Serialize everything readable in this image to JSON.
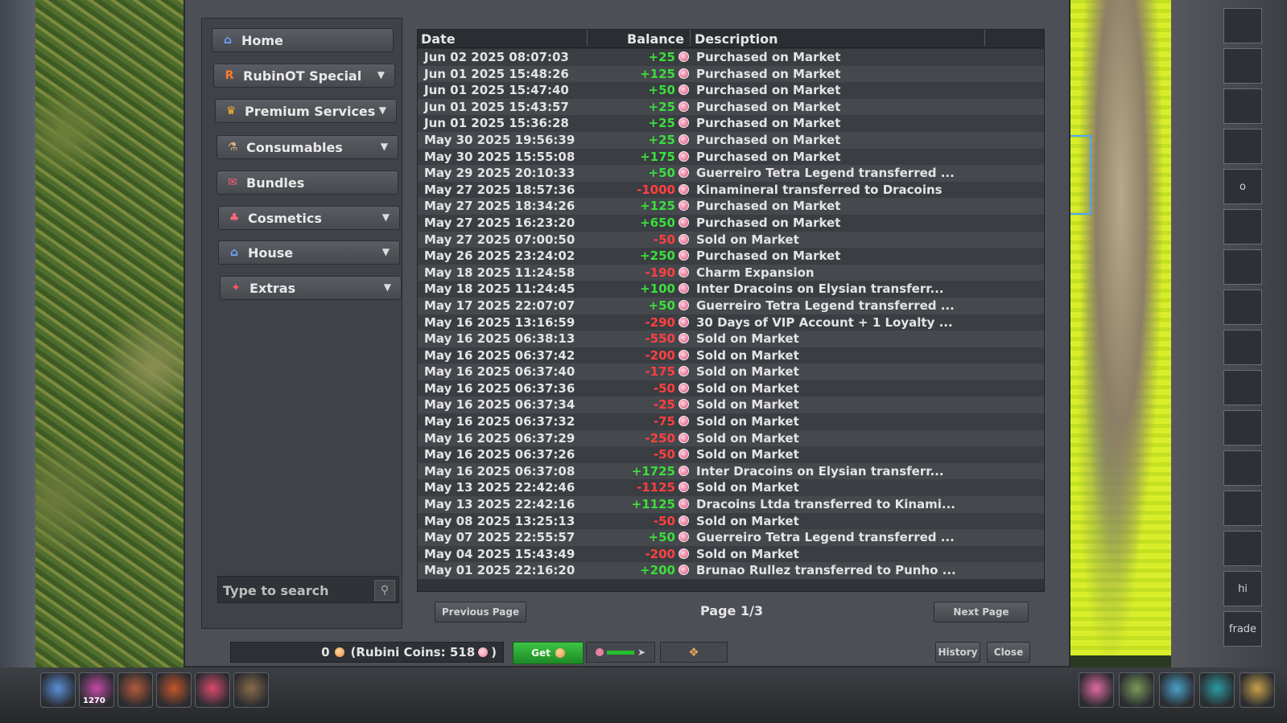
{
  "sidebar": {
    "items": [
      {
        "label": "Home",
        "icon": "house-icon",
        "has_dropdown": false
      },
      {
        "label": "RubinOT Special",
        "icon": "rubinot-logo-icon",
        "has_dropdown": true
      },
      {
        "label": "Premium Services",
        "icon": "crown-icon",
        "has_dropdown": true
      },
      {
        "label": "Consumables",
        "icon": "potion-icon",
        "has_dropdown": true
      },
      {
        "label": "Bundles",
        "icon": "gift-icon",
        "has_dropdown": false
      },
      {
        "label": "Cosmetics",
        "icon": "cosmetic-icon",
        "has_dropdown": true
      },
      {
        "label": "House",
        "icon": "house-icon",
        "has_dropdown": true
      },
      {
        "label": "Extras",
        "icon": "extras-icon",
        "has_dropdown": true
      }
    ],
    "search_placeholder": "Type to search"
  },
  "history": {
    "columns": {
      "date": "Date",
      "balance": "Balance",
      "description": "Description"
    },
    "rows": [
      {
        "date": "Jun 02 2025 08:07:03",
        "balance": "+25",
        "description": "Purchased on Market"
      },
      {
        "date": "Jun 01 2025 15:48:26",
        "balance": "+125",
        "description": "Purchased on Market"
      },
      {
        "date": "Jun 01 2025 15:47:40",
        "balance": "+50",
        "description": "Purchased on Market"
      },
      {
        "date": "Jun 01 2025 15:43:57",
        "balance": "+25",
        "description": "Purchased on Market"
      },
      {
        "date": "Jun 01 2025 15:36:28",
        "balance": "+25",
        "description": "Purchased on Market"
      },
      {
        "date": "May 30 2025 19:56:39",
        "balance": "+25",
        "description": "Purchased on Market"
      },
      {
        "date": "May 30 2025 15:55:08",
        "balance": "+175",
        "description": "Purchased on Market"
      },
      {
        "date": "May 29 2025 20:10:33",
        "balance": "+50",
        "description": "Guerreiro Tetra Legend transferred ..."
      },
      {
        "date": "May 27 2025 18:57:36",
        "balance": "-1000",
        "description": "Kinamineral transferred to Dracoins"
      },
      {
        "date": "May 27 2025 18:34:26",
        "balance": "+125",
        "description": "Purchased on Market"
      },
      {
        "date": "May 27 2025 16:23:20",
        "balance": "+650",
        "description": "Purchased on Market"
      },
      {
        "date": "May 27 2025 07:00:50",
        "balance": "-50",
        "description": "Sold on Market"
      },
      {
        "date": "May 26 2025 23:24:02",
        "balance": "+250",
        "description": "Purchased on Market"
      },
      {
        "date": "May 18 2025 11:24:58",
        "balance": "-190",
        "description": "Charm Expansion"
      },
      {
        "date": "May 18 2025 11:24:45",
        "balance": "+100",
        "description": "Inter Dracoins on Elysian transferr..."
      },
      {
        "date": "May 17 2025 22:07:07",
        "balance": "+50",
        "description": "Guerreiro Tetra Legend transferred ..."
      },
      {
        "date": "May 16 2025 13:16:59",
        "balance": "-290",
        "description": "30 Days of VIP Account + 1 Loyalty ..."
      },
      {
        "date": "May 16 2025 06:38:13",
        "balance": "-550",
        "description": "Sold on Market"
      },
      {
        "date": "May 16 2025 06:37:42",
        "balance": "-200",
        "description": "Sold on Market"
      },
      {
        "date": "May 16 2025 06:37:40",
        "balance": "-175",
        "description": "Sold on Market"
      },
      {
        "date": "May 16 2025 06:37:36",
        "balance": "-50",
        "description": "Sold on Market"
      },
      {
        "date": "May 16 2025 06:37:34",
        "balance": "-25",
        "description": "Sold on Market"
      },
      {
        "date": "May 16 2025 06:37:32",
        "balance": "-75",
        "description": "Sold on Market"
      },
      {
        "date": "May 16 2025 06:37:29",
        "balance": "-250",
        "description": "Sold on Market"
      },
      {
        "date": "May 16 2025 06:37:26",
        "balance": "-50",
        "description": "Sold on Market"
      },
      {
        "date": "May 16 2025 06:37:08",
        "balance": "+1725",
        "description": "Inter Dracoins on Elysian transferr..."
      },
      {
        "date": "May 13 2025 22:42:46",
        "balance": "-1125",
        "description": "Sold on Market"
      },
      {
        "date": "May 13 2025 22:42:16",
        "balance": "+1125",
        "description": "Dracoins Ltda transferred to Kinami..."
      },
      {
        "date": "May 08 2025 13:25:13",
        "balance": "-50",
        "description": "Sold on Market"
      },
      {
        "date": "May 07 2025 22:55:57",
        "balance": "+50",
        "description": "Guerreiro Tetra Legend transferred ..."
      },
      {
        "date": "May 04 2025 15:43:49",
        "balance": "-200",
        "description": "Sold on Market"
      },
      {
        "date": "May 01 2025 22:16:20",
        "balance": "+200",
        "description": "Brunao Rullez transferred to Punho ..."
      }
    ],
    "colors": {
      "positive": "#3bde3b",
      "negative": "#ff4040"
    }
  },
  "pagination": {
    "prev_label": "Previous Page",
    "page_info": "Page 1/3",
    "next_label": "Next Page"
  },
  "footer": {
    "coins_value": "0",
    "rubini_label": "(Rubini Coins: 518",
    "rubini_suffix": ")",
    "get_label": "Get",
    "history_label": "History",
    "close_label": "Close"
  },
  "side_panel": {
    "slot_labels": [
      "",
      "",
      "",
      "",
      "o",
      "",
      "",
      "",
      "",
      "",
      "",
      "",
      "",
      "",
      "hi",
      "frade"
    ]
  },
  "hotbar": {
    "first_count": "1270"
  }
}
